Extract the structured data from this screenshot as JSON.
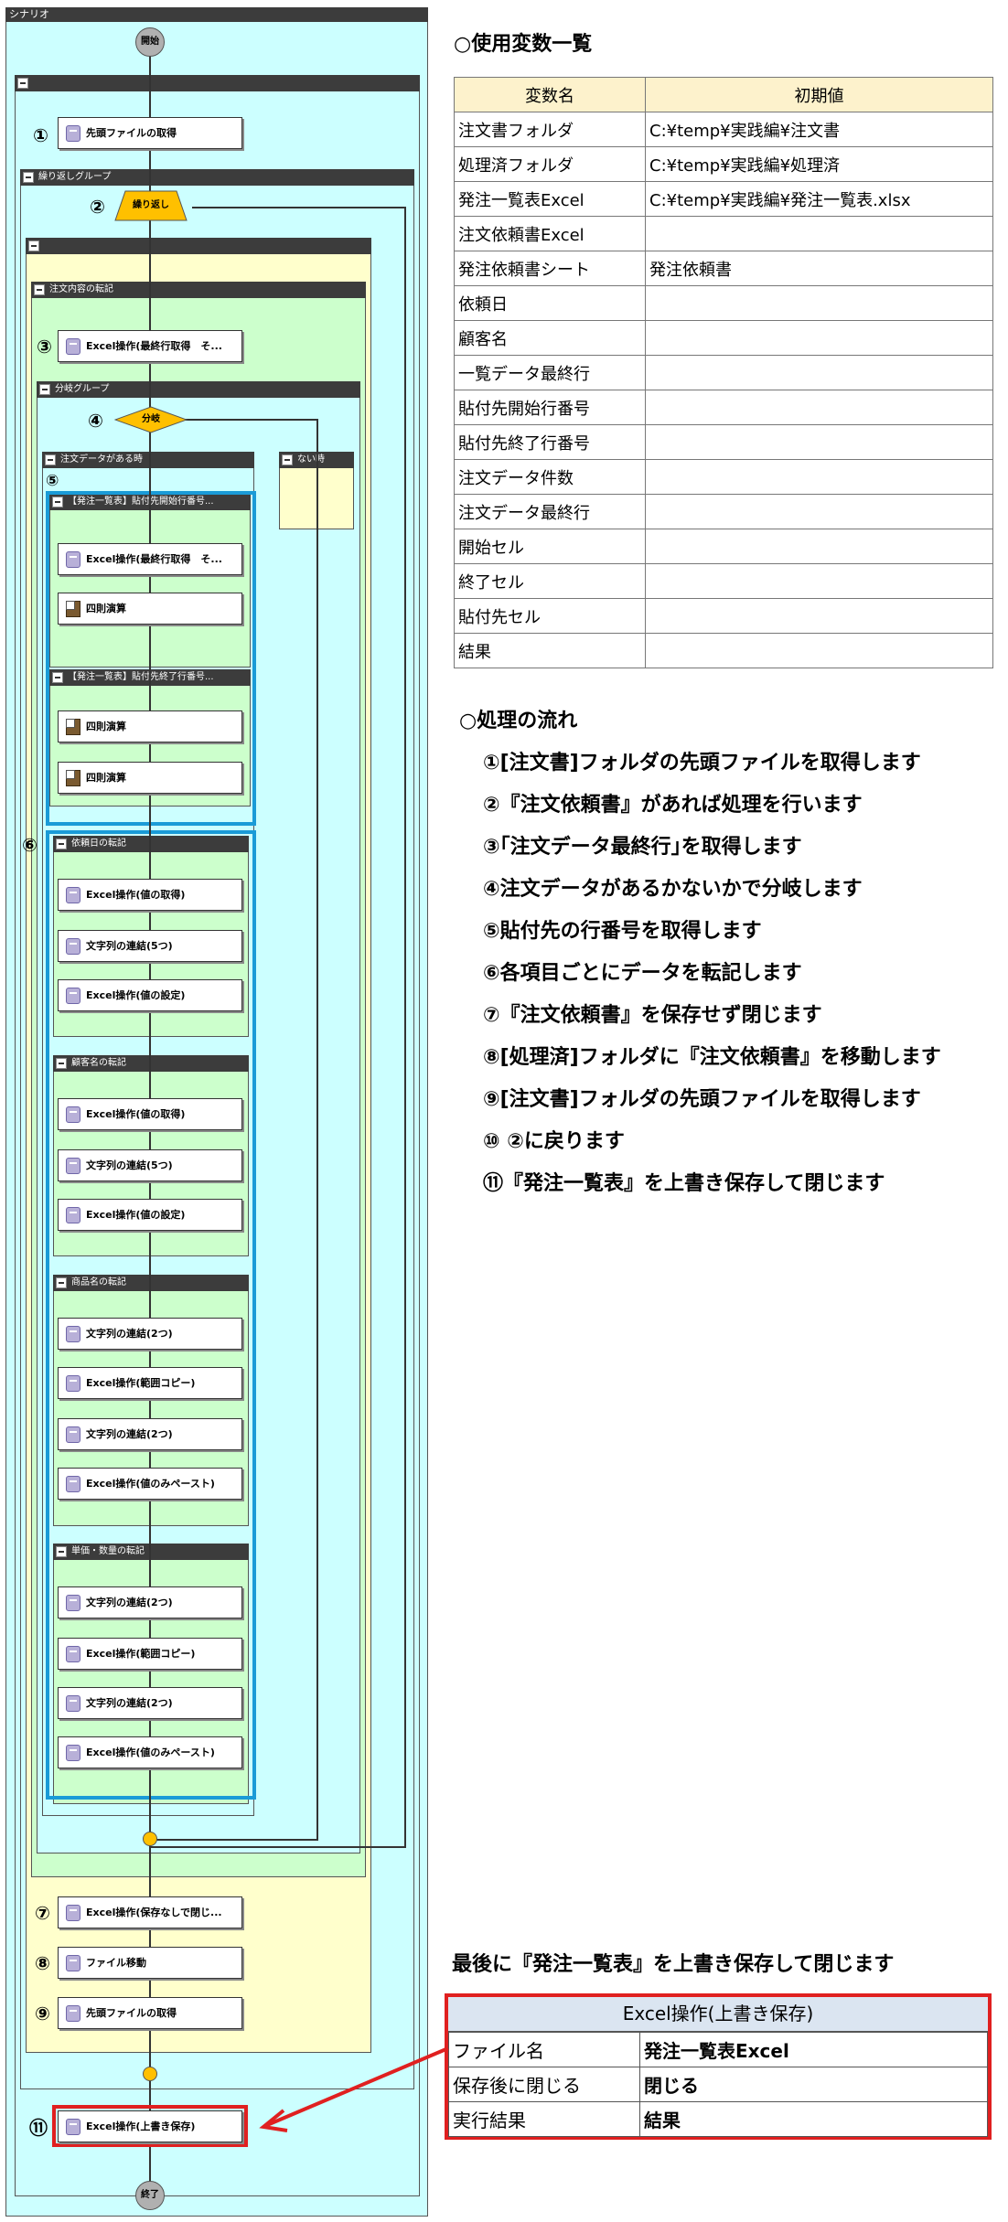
{
  "scenario": {
    "title": "シナリオ",
    "start": "開始",
    "end": "終了",
    "loop_group_label": "繰り返しグループ",
    "loop_label": "繰り返し",
    "transcribe_order_label": "注文内容の転記",
    "branch_group_label": "分岐グループ",
    "branch_label": "分岐",
    "has_data_label": "注文データがある時",
    "no_data_label": "ない時",
    "paste_start_label": "【発注一覧表】貼付先開始行番号...",
    "paste_end_label": "【発注一覧表】貼付先終了行番号...",
    "date_group_label": "依頼日の転記",
    "customer_group_label": "顧客名の転記",
    "product_group_label": "商品名の転記",
    "price_group_label": "単価・数量の転記",
    "act_get_first_file": "先頭ファイルの取得",
    "act_get_last_row": "Excel操作(最終行取得　そ...",
    "act_get_last_row2": "Excel操作(最終行取得　そ...",
    "act_arith": "四則演算",
    "act_get_value": "Excel操作(値の取得)",
    "act_concat5": "文字列の連結(5つ)",
    "act_set_value": "Excel操作(値の設定)",
    "act_concat2": "文字列の連結(2つ)",
    "act_range_copy": "Excel操作(範囲コピー)",
    "act_paste_values": "Excel操作(値のみペースト)",
    "act_close_nosave": "Excel操作(保存なしで閉じ...",
    "act_move_file": "ファイル移動",
    "act_overwrite": "Excel操作(上書き保存)",
    "markers": [
      "①",
      "②",
      "③",
      "④",
      "⑤",
      "⑥",
      "⑦",
      "⑧",
      "⑨",
      "⑪"
    ]
  },
  "variables": {
    "heading": "○使用変数一覧",
    "col_name": "変数名",
    "col_initial": "初期値",
    "rows": [
      [
        "注文書フォルダ",
        "C:¥temp¥実践編¥注文書"
      ],
      [
        "処理済フォルダ",
        "C:¥temp¥実践編¥処理済"
      ],
      [
        "発注一覧表Excel",
        "C:¥temp¥実践編¥発注一覧表.xlsx"
      ],
      [
        "注文依頼書Excel",
        ""
      ],
      [
        "発注依頼書シート",
        "発注依頼書"
      ],
      [
        "依頼日",
        ""
      ],
      [
        "顧客名",
        ""
      ],
      [
        "一覧データ最終行",
        ""
      ],
      [
        "貼付先開始行番号",
        ""
      ],
      [
        "貼付先終了行番号",
        ""
      ],
      [
        "注文データ件数",
        ""
      ],
      [
        "注文データ最終行",
        ""
      ],
      [
        "開始セル",
        ""
      ],
      [
        "終了セル",
        ""
      ],
      [
        "貼付先セル",
        ""
      ],
      [
        "結果",
        ""
      ]
    ]
  },
  "flow": {
    "heading": "○処理の流れ",
    "steps": [
      "①[注文書]フォルダの先頭ファイルを取得します",
      "②『注文依頼書』があれば処理を行います",
      "③｢注文データ最終行｣を取得します",
      "④注文データがあるかないかで分岐します",
      "⑤貼付先の行番号を取得します",
      "⑥各項目ごとにデータを転記します",
      "⑦『注文依頼書』を保存せず閉じます",
      "⑧[処理済]フォルダに『注文依頼書』を移動します",
      "⑨[注文書]フォルダの先頭ファイルを取得します",
      "⑩ ②に戻ります",
      "⑪『発注一覧表』を上書き保存して閉じます"
    ]
  },
  "final": {
    "heading": "最後に『発注一覧表』を上書き保存して閉じます",
    "table_title": "Excel操作(上書き保存)",
    "rows": [
      [
        "ファイル名",
        "発注一覧表Excel"
      ],
      [
        "保存後に閉じる",
        "閉じる"
      ],
      [
        "実行結果",
        "結果"
      ]
    ]
  },
  "colors": {
    "scenario_bg": "#ccffff",
    "group_yellow": "#ffffcc",
    "group_green": "#ccffcc",
    "highlight_blue": "#1a9bd7",
    "highlight_red": "#e02020",
    "loop_fill": "#ffc000"
  }
}
